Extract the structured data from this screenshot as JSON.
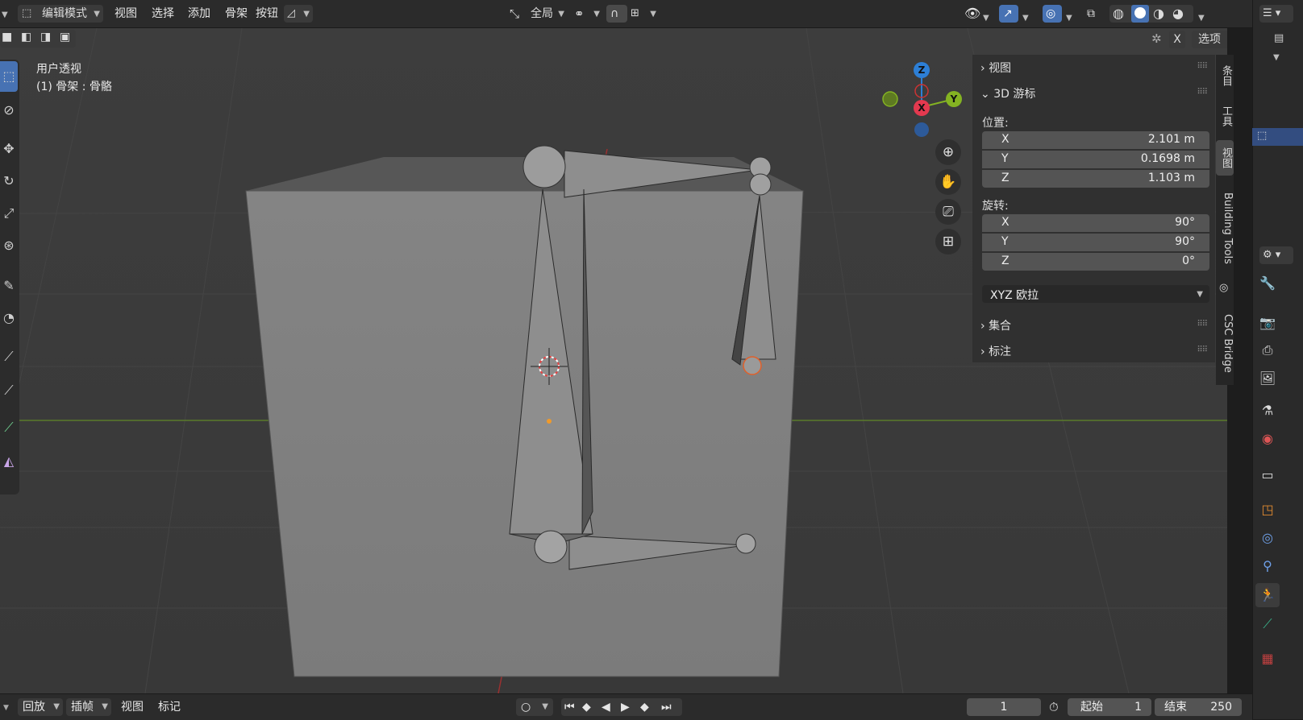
{
  "header": {
    "mode": "编辑模式",
    "menus": [
      "视图",
      "选择",
      "添加",
      "骨架",
      "按钮"
    ],
    "transform_orientation": "全局",
    "options_label": "选项",
    "xray_label": "X"
  },
  "viewport": {
    "view_name": "用户透视",
    "object_info": "(1) 骨架 : 骨骼",
    "gizmo": {
      "z": "Z",
      "x": "X",
      "y": "Y"
    }
  },
  "npanel": {
    "view_section": "视图",
    "cursor_section": "3D 游标",
    "location_label": "位置:",
    "location": [
      {
        "axis": "X",
        "value": "2.101 m"
      },
      {
        "axis": "Y",
        "value": "0.1698 m"
      },
      {
        "axis": "Z",
        "value": "1.103 m"
      }
    ],
    "rotation_label": "旋转:",
    "rotation": [
      {
        "axis": "X",
        "value": "90°"
      },
      {
        "axis": "Y",
        "value": "90°"
      },
      {
        "axis": "Z",
        "value": "0°"
      }
    ],
    "rotation_mode": "XYZ 欧拉",
    "collection_section": "集合",
    "annotation_section": "标注"
  },
  "side_tabs": [
    "条目",
    "工具",
    "视图",
    "Building Tools",
    "CSC Bridge"
  ],
  "timeline": {
    "menus": [
      "回放",
      "插帧",
      "视图",
      "标记"
    ],
    "current_frame": "1",
    "start_label": "起始",
    "start_value": "1",
    "end_label": "结束",
    "end_value": "250"
  },
  "colors": {
    "accent": "#4772b3",
    "axis_x": "#e3394f",
    "axis_y": "#84b322",
    "axis_z": "#2d7fd6",
    "active_green": "#3ab38a"
  },
  "icons": {
    "outliner": "outliner-icon",
    "tool_props": "wrench-icon",
    "render": "render-icon",
    "output": "printer-icon",
    "view_layer": "view-layer-icon",
    "scene": "scene-icon",
    "world": "world-icon",
    "collection": "collection-icon",
    "object": "object-icon",
    "modifiers": "modifier-icon",
    "constraints": "constraint-icon",
    "armature_data": "armature-data-icon",
    "bone": "bone-icon",
    "texture": "texture-icon"
  }
}
